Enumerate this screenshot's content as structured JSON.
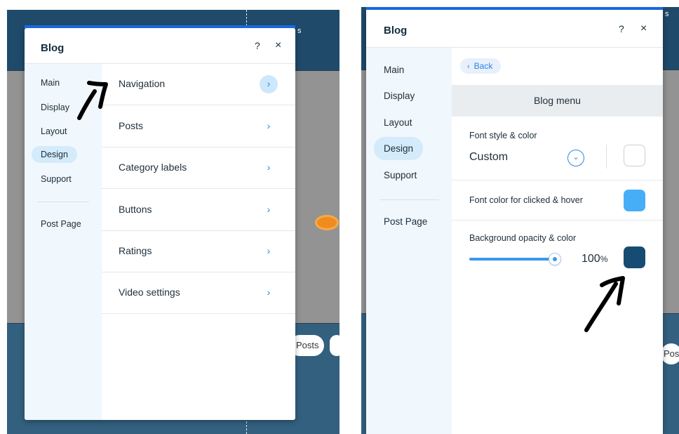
{
  "left_canvas": {
    "posts_pill": "Posts",
    "topbar_fragment": "s"
  },
  "right_canvas": {
    "posts_pill": "Post",
    "topbar_fragment": "s"
  },
  "left_panel": {
    "title": "Blog",
    "help": "?",
    "close": "×",
    "sidebar": {
      "items": [
        {
          "label": "Main"
        },
        {
          "label": "Display"
        },
        {
          "label": "Layout"
        },
        {
          "label": "Design",
          "active": true
        },
        {
          "label": "Support"
        }
      ],
      "post_page": "Post Page"
    },
    "rows": [
      {
        "label": "Navigation",
        "chevron": "›",
        "highlighted": true
      },
      {
        "label": "Posts",
        "chevron": "›"
      },
      {
        "label": "Category labels",
        "chevron": "›"
      },
      {
        "label": "Buttons",
        "chevron": "›"
      },
      {
        "label": "Ratings",
        "chevron": "›"
      },
      {
        "label": "Video settings",
        "chevron": "›"
      }
    ]
  },
  "right_panel": {
    "title": "Blog",
    "help": "?",
    "close": "×",
    "sidebar": {
      "items": [
        {
          "label": "Main"
        },
        {
          "label": "Display"
        },
        {
          "label": "Layout"
        },
        {
          "label": "Design",
          "active": true
        },
        {
          "label": "Support"
        }
      ],
      "post_page": "Post Page"
    },
    "back": {
      "icon": "‹",
      "label": "Back"
    },
    "section_title": "Blog menu",
    "font_style": {
      "label": "Font style & color",
      "value": "Custom",
      "swatch_color": "#ffffff"
    },
    "font_hover": {
      "label": "Font color for clicked & hover",
      "swatch_color": "#46aef7"
    },
    "background": {
      "label": "Background opacity & color",
      "opacity_value": "100",
      "opacity_unit": "%",
      "swatch_color": "#164c73"
    }
  },
  "colors": {
    "accent": "#1a6ef0",
    "link_blue": "#2f83e6",
    "annotation_arrows": "#000000"
  }
}
